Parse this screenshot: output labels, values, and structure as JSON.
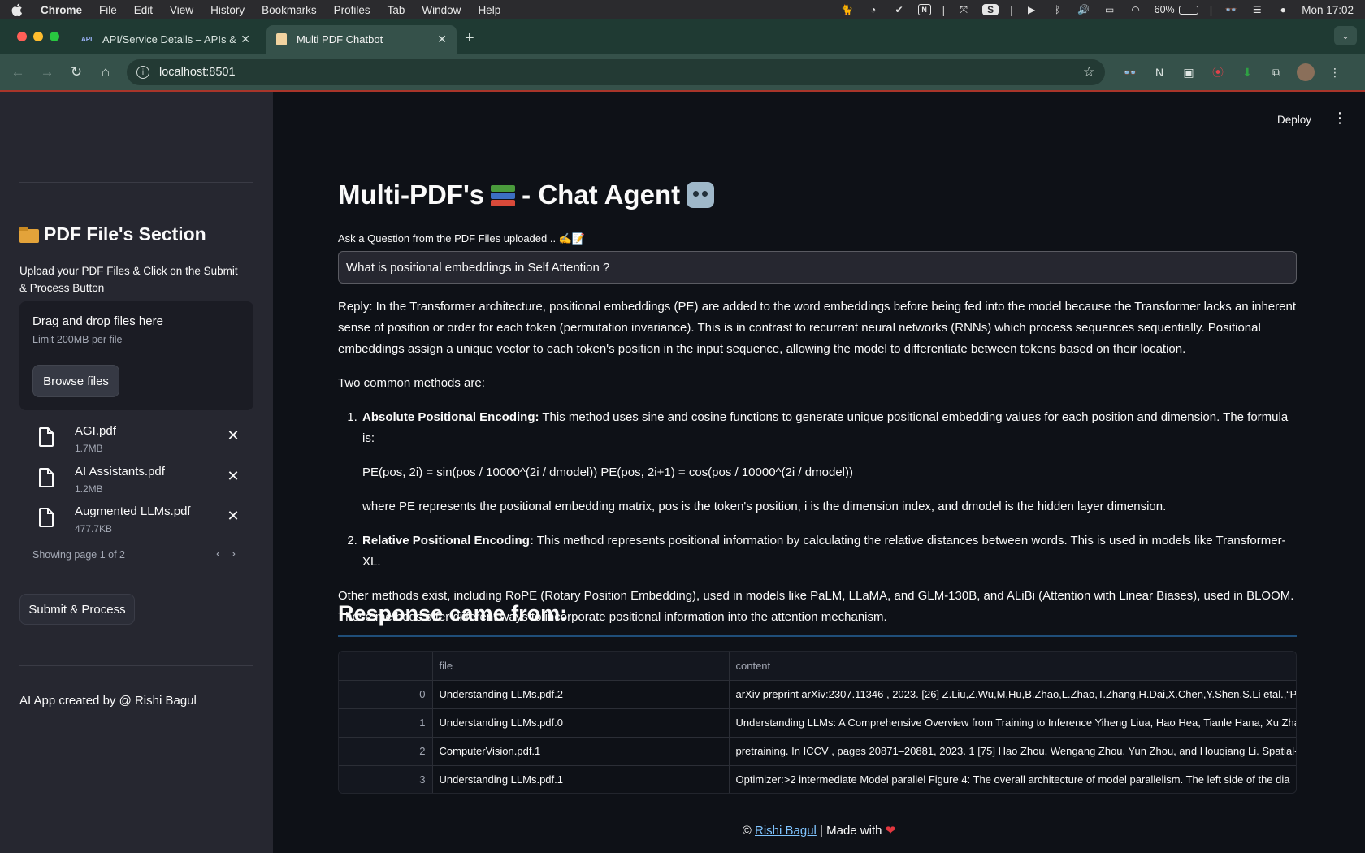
{
  "menubar": {
    "items": [
      "Chrome",
      "File",
      "Edit",
      "View",
      "History",
      "Bookmarks",
      "Profiles",
      "Tab",
      "Window",
      "Help"
    ],
    "battery": "60%",
    "battery_level": 0.6,
    "clock": "Mon 17:02"
  },
  "browser": {
    "tabs": [
      {
        "title": "API/Service Details – APIs & S",
        "favicon": "API"
      },
      {
        "title": "Multi PDF Chatbot",
        "favicon": "page"
      }
    ],
    "url": "localhost:8501"
  },
  "sidebar": {
    "title": "PDF File's Section",
    "description": "Upload your PDF Files & Click on the Submit & Process Button",
    "dropzone_title": "Drag and drop files here",
    "dropzone_limit": "Limit 200MB per file",
    "browse_label": "Browse files",
    "files": [
      {
        "name": "AGI.pdf",
        "size": "1.7MB"
      },
      {
        "name": "AI Assistants.pdf",
        "size": "1.2MB"
      },
      {
        "name": "Augmented LLMs.pdf",
        "size": "477.7KB"
      }
    ],
    "pager": "Showing page 1 of 2",
    "submit_label": "Submit & Process",
    "footer": "AI App created by @ Rishi Bagul"
  },
  "main": {
    "deploy_label": "Deploy",
    "title": "Multi-PDF's",
    "title_suffix": "- Chat Agent",
    "prompt_label": "Ask a Question from the PDF Files uploaded .. ✍️📝",
    "question_value": "What is positional embeddings in Self Attention ?",
    "reply_intro": "Reply: In the Transformer architecture, positional embeddings (PE) are added to the word embeddings before being fed into the model because the Transformer lacks an inherent sense of position or order for each token (permutation invariance). This is in contrast to recurrent neural networks (RNNs) which process sequences sequentially. Positional embeddings assign a unique vector to each token's position in the input sequence, allowing the model to differentiate between tokens based on their location.",
    "reply_methods": "Two common methods are:",
    "method1_title": "Absolute Positional Encoding:",
    "method1_text": " This method uses sine and cosine functions to generate unique positional embedding values for each position and dimension. The formula is:",
    "method1_formula": "PE(pos, 2i) = sin(pos / 10000^(2i / dmodel)) PE(pos, 2i+1) = cos(pos / 10000^(2i / dmodel))",
    "method1_where": "where PE represents the positional embedding matrix, pos is the token's position, i is the dimension index, and dmodel is the hidden layer dimension.",
    "method2_title": "Relative Positional Encoding:",
    "method2_text": " This method represents positional information by calculating the relative distances between words. This is used in models like Transformer-XL.",
    "reply_other": "Other methods exist, including RoPE (Rotary Position Embedding), used in models like PaLM, LLaMA, and GLM-130B, and ALiBi (Attention with Linear Biases), used in BLOOM. These methods offer different ways to incorporate positional information into the attention mechanism.",
    "response_heading": "Response came from:",
    "table": {
      "columns": [
        "",
        "file",
        "content"
      ],
      "rows": [
        [
          "0",
          "Understanding LLMs.pdf.2",
          "arXiv preprint arXiv:2307.11346 , 2023. [26] Z.Liu,Z.Wu,M.Hu,B.Zhao,L.Zhao,T.Zhang,H.Dai,X.Chen,Y.Shen,S.Li etal.,“Phar"
        ],
        [
          "1",
          "Understanding LLMs.pdf.0",
          "Understanding LLMs: A Comprehensive Overview from Training to Inference Yiheng Liua, Hao Hea, Tianle Hana, Xu Zhan"
        ],
        [
          "2",
          "ComputerVision.pdf.1",
          "pretraining. In ICCV , pages 20871–20881, 2023. 1 [75] Hao Zhou, Wengang Zhou, Yun Zhou, and Houqiang Li. Spatial-ten"
        ],
        [
          "3",
          "Understanding LLMs.pdf.1",
          "Optimizer:>2 intermediate Model parallel Figure 4: The overall architecture of model parallelism. The left side of the dia"
        ]
      ]
    },
    "footer_prefix": "© ",
    "footer_link": "Rishi Bagul",
    "footer_suffix": " | Made with ",
    "footer_heart": "❤"
  }
}
